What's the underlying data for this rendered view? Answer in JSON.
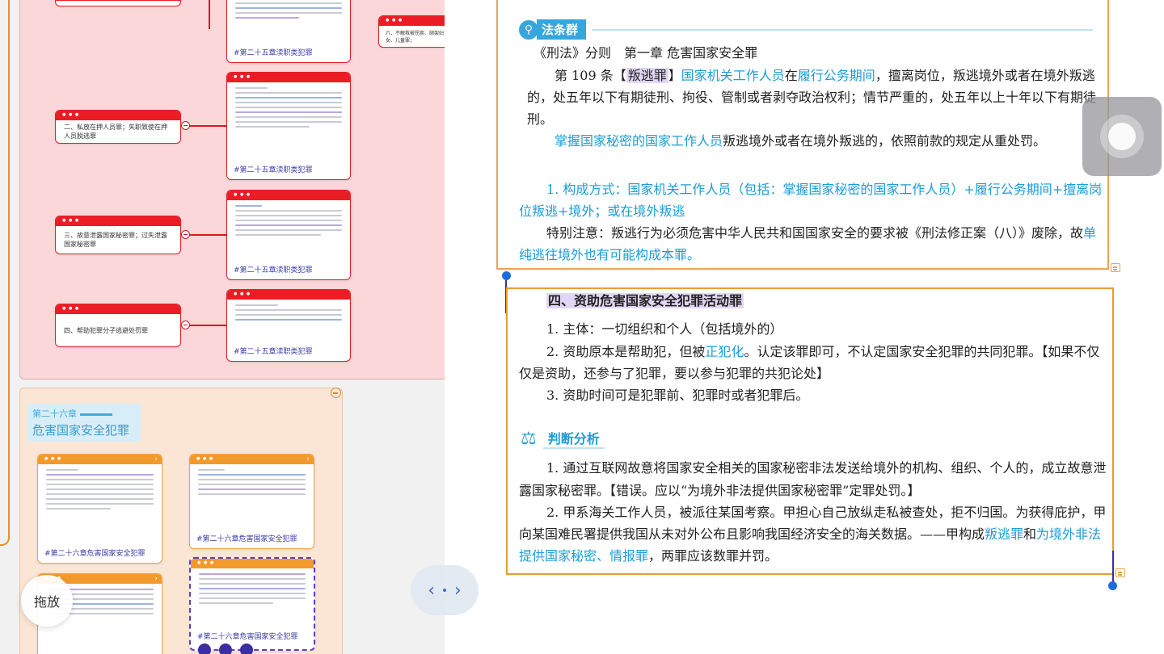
{
  "mindmap": {
    "chapter": {
      "number": "第二十六章",
      "title": "危害国家安全犯罪"
    },
    "nodes": [
      {
        "label": "二、私放在押人员罪；失职致使在押人员脱逃罪"
      },
      {
        "label": "三、故意泄露国家秘密罪；过失泄露国家秘密罪"
      },
      {
        "label": "四、帮助犯罪分子逃避处罚罪"
      },
      {
        "label": "六、不解救被拐卖、绑架妇女、儿童罪；"
      }
    ],
    "card_tags": {
      "ch25": "#第二十五章渎职类犯罪",
      "ch26": "#第二十六章危害国家安全犯罪"
    },
    "drag_label": "拖放",
    "colors": {
      "node_red": "#ec1c24",
      "group_pink": "#fbd7da",
      "group_peach": "#fbe6d6",
      "card_orange": "#f39a2c",
      "select_purple": "#5b3fc0"
    }
  },
  "document": {
    "law_badge": "法条群",
    "law_heading": "《刑法》分则　第一章 危害国家安全罪",
    "art109": {
      "prefix": "第 109 条【",
      "crime": "叛逃罪",
      "bracket_close": "】",
      "subject": "国家机关工作人员",
      "mid1": "在",
      "period": "履行公务期间",
      "rest1": "，擅离岗位，叛逃境外或者在境外叛逃",
      "line2": "的，处五年以下有期徒刑、拘役、管制或者剥夺政治权利；情节严重的，处五年以上十年以下有期徒",
      "line3": "刑。"
    },
    "secret_para": {
      "subject": "掌握国家秘密的国家工作人员",
      "rest": "叛逃境外或者在境外叛逃的，依照前款的规定从重处罚。"
    },
    "composition": {
      "line1": "1. 构成方式：国家机关工作人员（包括：掌握国家秘密的国家工作人员）+履行公务期间+擅离岗",
      "line2": "位叛逃+境外；或在境外叛逃"
    },
    "special_note": {
      "label": "特别注意：",
      "text": "叛逃行为必须危害中华人民共和国国家安全的要求被《刑法修正案（八）》废除，故",
      "tail": "单",
      "line2": "纯逃往境外也有可能构成本罪。"
    },
    "section4": {
      "title": "四、资助危害国家安全犯罪活动罪",
      "p1": "1. 主体：一切组织和个人（包括境外的）",
      "p2a": "2. 资助原本是帮助犯，但被",
      "p2b": "正犯化",
      "p2c": "。认定该罪即可，不认定国家安全犯罪的共同犯罪。【如果不仅",
      "p2d": "仅是资助，还参与了犯罪，要以参与犯罪的共犯论处】",
      "p3": "3. 资助时间可是犯罪前、犯罪时或者犯罪后。"
    },
    "judge": {
      "label": "判断分析",
      "q1a": "1. 通过互联网故意将国家安全相关的国家秘密非法发送给境外的机构、组织、个人的，成立故意泄",
      "q1b": "露国家秘密罪。【错误。应以“为境外非法提供国家秘密罪”定罪处罚。】",
      "q2a": "2. 甲系海关工作人员，被派往某国考察。甲担心自己放纵走私被查处，拒不归国。为获得庇护，甲",
      "q2b": "向某国难民署提供我国从未对外公布且影响我国经济安全的海关数据。——甲构成",
      "q2c1": "叛逃罪",
      "q2c2": "和",
      "q2c3": "为境外非法",
      "q2d1": "提供国家秘密、情报罪",
      "q2d2": "，两罪应该数罪并罚。"
    },
    "colors": {
      "accent_blue": "#1b9cd8",
      "box_orange": "#f09a30",
      "highlight_purple": "#e1d7f5",
      "underline_blue": "#2a2ae0"
    }
  }
}
